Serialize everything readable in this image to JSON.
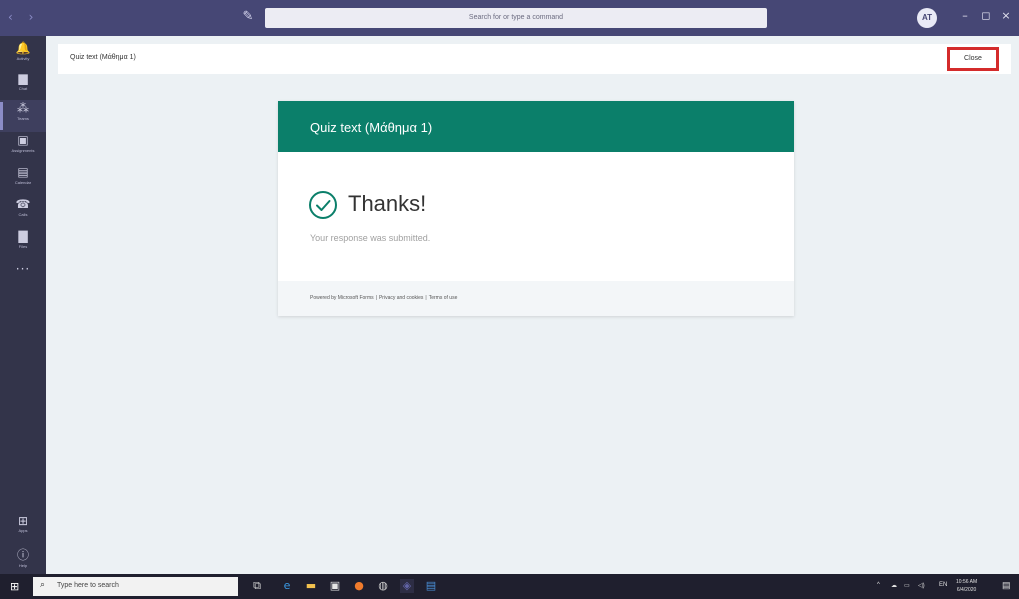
{
  "window": {
    "nav_arrows": "‹ ›",
    "search_placeholder": "Search for or type a command",
    "avatar_initials": "AT",
    "minimize": "–",
    "maximize": "◻",
    "close": "×"
  },
  "rail": {
    "items": [
      {
        "label": "Activity",
        "icon": "bell-icon",
        "glyph": "🔔"
      },
      {
        "label": "Chat",
        "icon": "chat-icon",
        "glyph": "▆"
      },
      {
        "label": "Teams",
        "icon": "teams-icon",
        "glyph": "⁂",
        "active": true
      },
      {
        "label": "Assignments",
        "icon": "assignments-icon",
        "glyph": "▣"
      },
      {
        "label": "Calendar",
        "icon": "calendar-icon",
        "glyph": "▤"
      },
      {
        "label": "Calls",
        "icon": "phone-icon",
        "glyph": "☎"
      },
      {
        "label": "Files",
        "icon": "file-icon",
        "glyph": "▇"
      }
    ],
    "more": "···",
    "apps_label": "Apps",
    "help_label": "Help"
  },
  "header": {
    "title": "Quiz text (Μάθημα 1)",
    "close_label": "Close"
  },
  "card": {
    "title": "Quiz text (Μάθημα 1)",
    "thanks": "Thanks!",
    "response": "Your response was submitted.",
    "footer": {
      "powered": "Powered by Microsoft Forms",
      "privacy": "Privacy and cookies",
      "terms": "Terms of use"
    }
  },
  "colors": {
    "accent": "#0b7f6a",
    "highlight": "#d42b2b",
    "teams_purple": "#464775"
  },
  "taskbar": {
    "search_placeholder": "Type here to search",
    "clock_time": "10:56 AM",
    "clock_date": "6/4/2020",
    "tray_lang": "EN"
  }
}
